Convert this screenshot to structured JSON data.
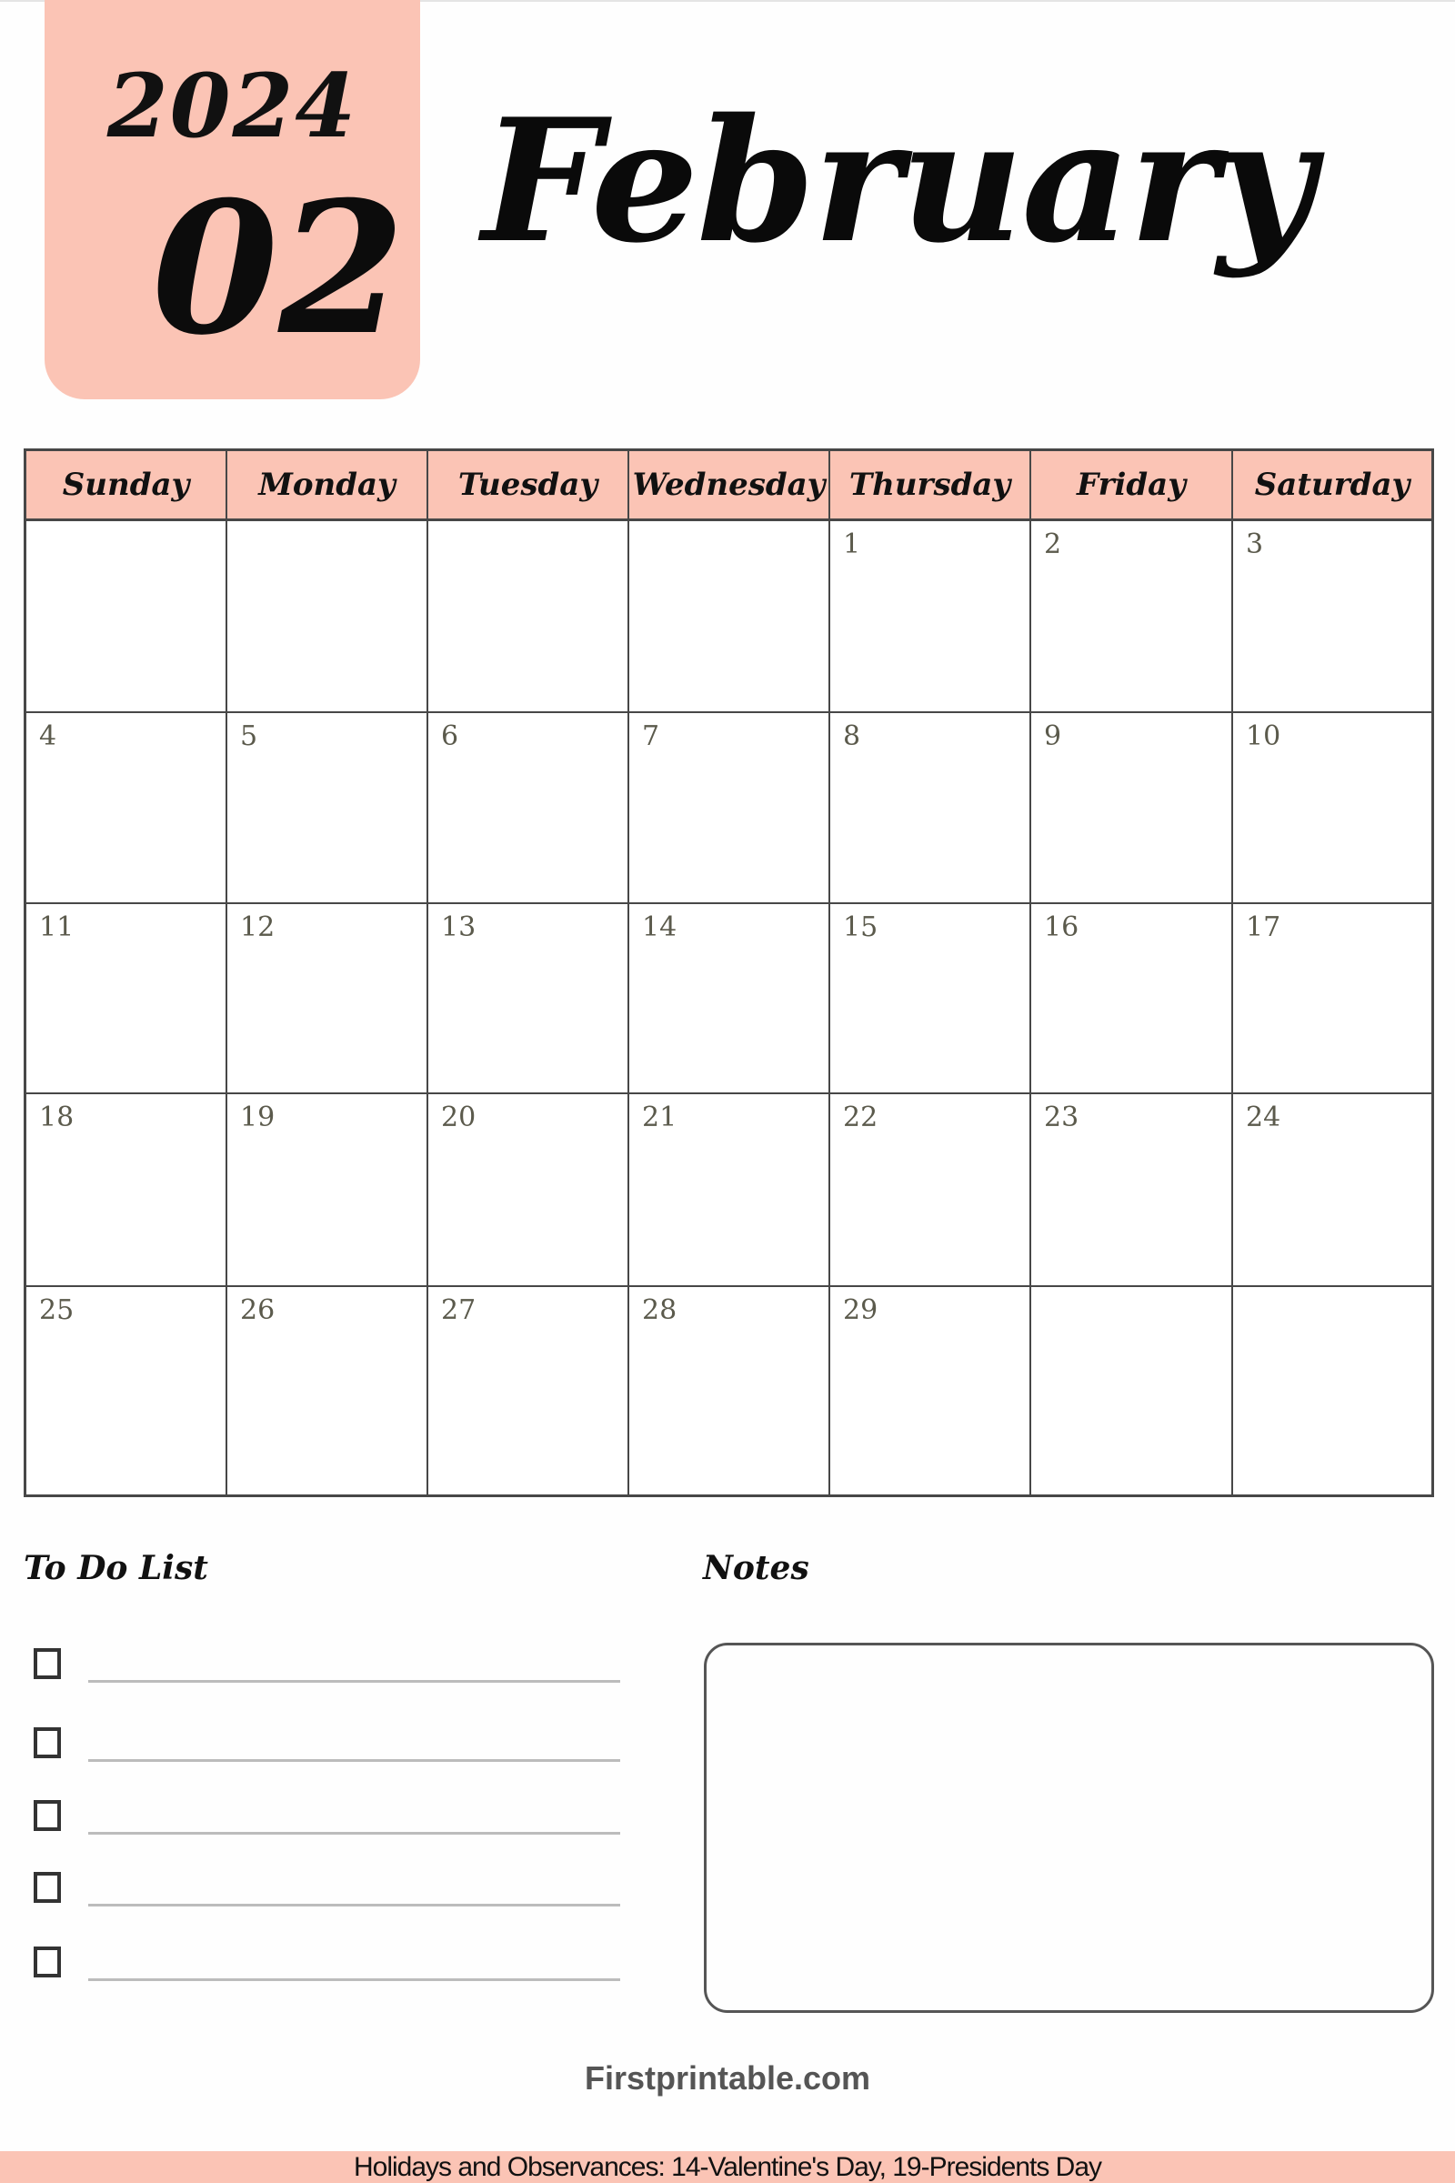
{
  "header": {
    "year": "2024",
    "month_number": "02",
    "month_name": "February"
  },
  "calendar": {
    "weekdays": [
      "Sunday",
      "Monday",
      "Tuesday",
      "Wednesday",
      "Thursday",
      "Friday",
      "Saturday"
    ],
    "weeks": [
      [
        "",
        "",
        "",
        "",
        "1",
        "2",
        "3"
      ],
      [
        "4",
        "5",
        "6",
        "7",
        "8",
        "9",
        "10"
      ],
      [
        "11",
        "12",
        "13",
        "14",
        "15",
        "16",
        "17"
      ],
      [
        "18",
        "19",
        "20",
        "21",
        "22",
        "23",
        "24"
      ],
      [
        "25",
        "26",
        "27",
        "28",
        "29",
        "",
        ""
      ]
    ]
  },
  "todo": {
    "title": "To Do List",
    "items": [
      "",
      "",
      "",
      "",
      ""
    ]
  },
  "notes": {
    "title": "Notes",
    "content": ""
  },
  "brand": "Firstprintable.com",
  "footer": "Holidays and Observances: 14-Valentine's Day, 19-Presidents Day",
  "colors": {
    "accent": "#fbc4b5",
    "border": "#474747",
    "date_text": "#5b5a4c"
  }
}
